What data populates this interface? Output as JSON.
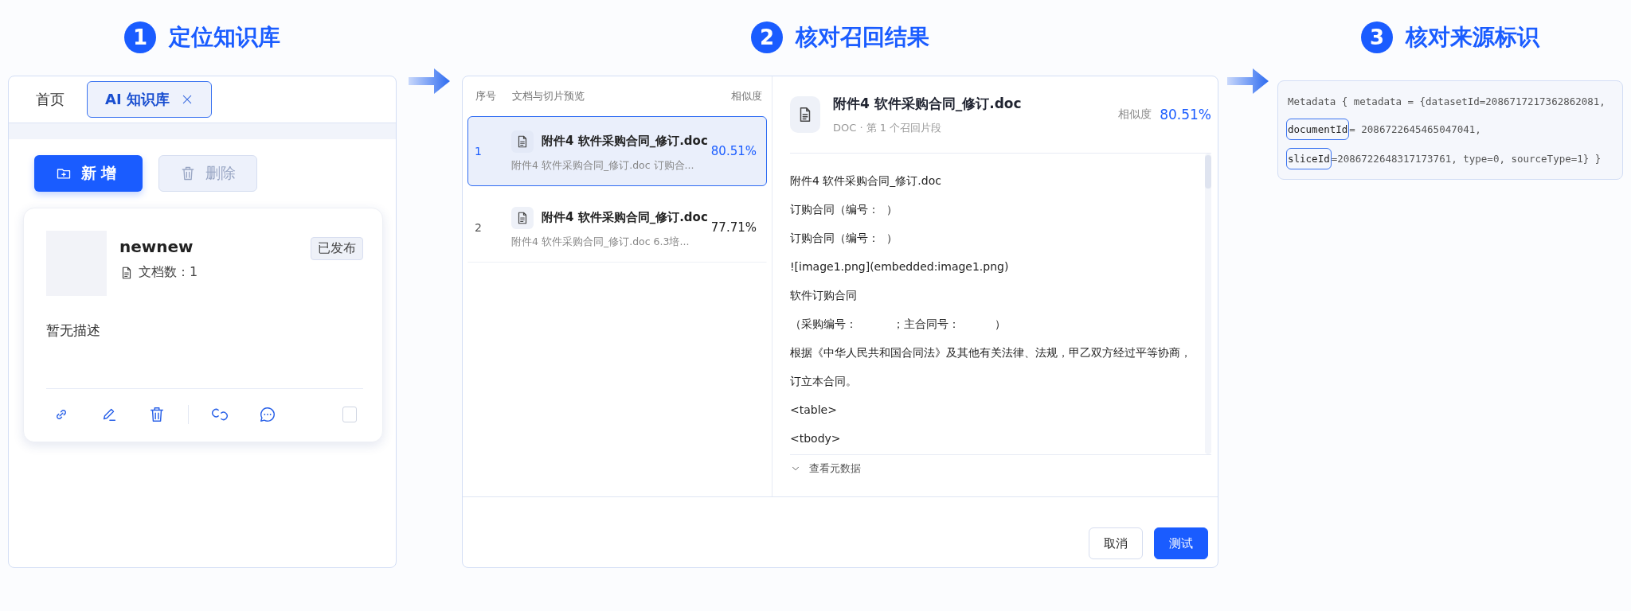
{
  "steps": [
    {
      "number": "1",
      "title": "定位知识库"
    },
    {
      "number": "2",
      "title": "核对召回结果"
    },
    {
      "number": "3",
      "title": "核对来源标识"
    }
  ],
  "knowledge_panel": {
    "tabs": [
      {
        "label": "首页",
        "selected": false,
        "closable": false
      },
      {
        "label": "AI 知识库",
        "selected": true,
        "closable": true
      }
    ],
    "buttons": [
      {
        "label": "新增",
        "kind": "primary",
        "disabled": false
      },
      {
        "label": "删除",
        "kind": "delete",
        "disabled": true
      }
    ],
    "card": {
      "name": "newnew",
      "doc_count": "文档数：1",
      "status": "已发布",
      "description": "暂无描述",
      "checked": false
    }
  },
  "recall_panel": {
    "columns": [
      "序号",
      "文档与切片预览",
      "相似度"
    ],
    "results": [
      {
        "index": "1",
        "title": "附件4 软件采购合同_修订.doc",
        "snippet": "附件4 软件采购合同_修订.doc 订购合...",
        "score": "80.51%",
        "selected": true
      },
      {
        "index": "2",
        "title": "附件4 软件采购合同_修订.doc",
        "snippet": "附件4 软件采购合同_修订.doc 6.3培...",
        "score": "77.71%",
        "selected": false
      }
    ],
    "detail": {
      "title": "附件4 软件采购合同_修订.doc",
      "subtitle": "DOC · 第 1 个召回片段",
      "score_label": "相似度",
      "score": "80.51%",
      "lines": [
        "附件4 软件采购合同_修订.doc",
        "订购合同（编号：  ）",
        "订购合同（编号：  ）",
        "![image1.png](embedded:image1.png)",
        "软件订购合同",
        "（采购编号：          ；主合同号：          ）",
        "根据《中华人民共和国合同法》及其他有关法律、法规，甲乙双方经过平等协商，",
        "订立本合同。",
        "<table>",
        "<tbody>"
      ],
      "metadata_toggle": "查看元数据"
    },
    "buttons": [
      {
        "label": "取消",
        "kind": "default"
      },
      {
        "label": "测试",
        "kind": "primary"
      }
    ]
  },
  "metadata": {
    "lines": [
      {
        "segments": [
          {
            "text": "Metadata { metadata = {datasetId=2086717217362862081,",
            "highlighted": false
          }
        ]
      },
      {
        "segments": [
          {
            "text": "documentId",
            "highlighted": true
          },
          {
            "text": "= 2086722645465047041,",
            "highlighted": false
          }
        ]
      },
      {
        "segments": [
          {
            "text": "sliceId",
            "highlighted": true
          },
          {
            "text": "=2086722648317173761, type=0, sourceType=1} }",
            "highlighted": false
          }
        ]
      }
    ]
  }
}
